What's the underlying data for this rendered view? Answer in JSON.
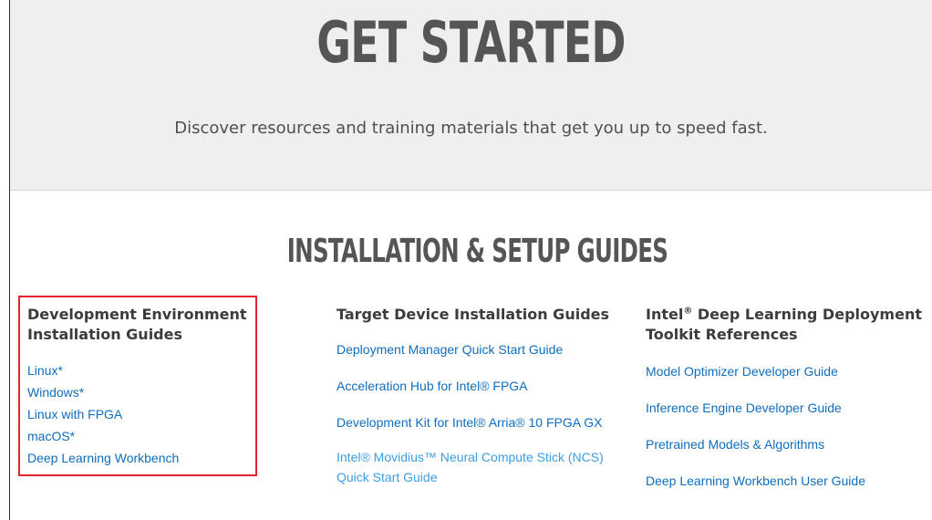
{
  "hero": {
    "title": "GET STARTED",
    "subtitle": "Discover resources and training materials that get you up to speed fast."
  },
  "section": {
    "title": "INSTALLATION & SETUP GUIDES"
  },
  "columns": {
    "dev_env": {
      "heading": "Development Environment Installation Guides",
      "links": [
        "Linux*",
        "Windows*",
        "Linux with FPGA",
        "macOS*",
        "Deep Learning Workbench"
      ]
    },
    "target_device": {
      "heading": "Target Device Installation Guides",
      "links": [
        "Deployment Manager Quick Start Guide",
        "Acceleration Hub for Intel® FPGA",
        "Development Kit for Intel® Arria® 10 FPGA GX",
        "Intel® Movidius™ Neural Compute Stick (NCS) Quick Start Guide"
      ]
    },
    "toolkit_refs": {
      "heading_pre": "Intel",
      "heading_sup": "®",
      "heading_post": " Deep Learning Deployment Toolkit References",
      "links": [
        "Model Optimizer Developer Guide",
        "Inference Engine Developer Guide",
        "Pretrained Models & Algorithms",
        "Deep Learning Workbench User Guide"
      ]
    }
  },
  "colors": {
    "link": "#0f6ebd",
    "visited_link": "#3b9ee0",
    "highlight": "#e3262b",
    "hero_bg": "#efefef"
  }
}
